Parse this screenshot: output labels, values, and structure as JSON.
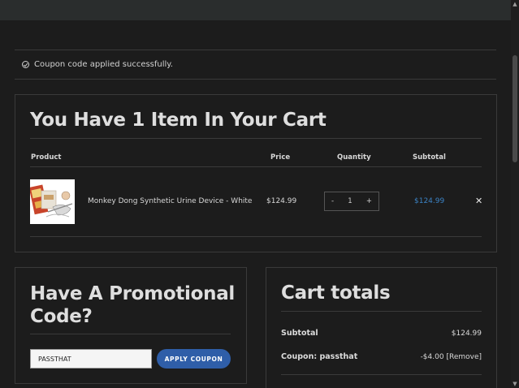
{
  "notice": {
    "text": "Coupon code applied successfully.",
    "icon": "check-circle-icon"
  },
  "cart": {
    "title": "You Have 1 Item In Your Cart",
    "headers": {
      "product": "Product",
      "price": "Price",
      "quantity": "Quantity",
      "subtotal": "Subtotal"
    },
    "items": [
      {
        "name": "Monkey Dong Synthetic Urine Device - White",
        "price": "$124.99",
        "quantity": "1",
        "minus": "-",
        "plus": "+",
        "subtotal": "$124.99",
        "remove": "✕"
      }
    ]
  },
  "promo": {
    "title": "Have A Promotional Code?",
    "input_value": "PASSTHAT",
    "button_label": "APPLY COUPON"
  },
  "totals": {
    "title": "Cart totals",
    "subtotal_label": "Subtotal",
    "subtotal_value": "$124.99",
    "coupon_label": "Coupon: passthat",
    "coupon_value": "-$4.00",
    "coupon_remove": "[Remove]"
  },
  "colors": {
    "background": "#1c1c1c",
    "accent_link": "#3b82c4",
    "button": "#2f5ea8"
  }
}
